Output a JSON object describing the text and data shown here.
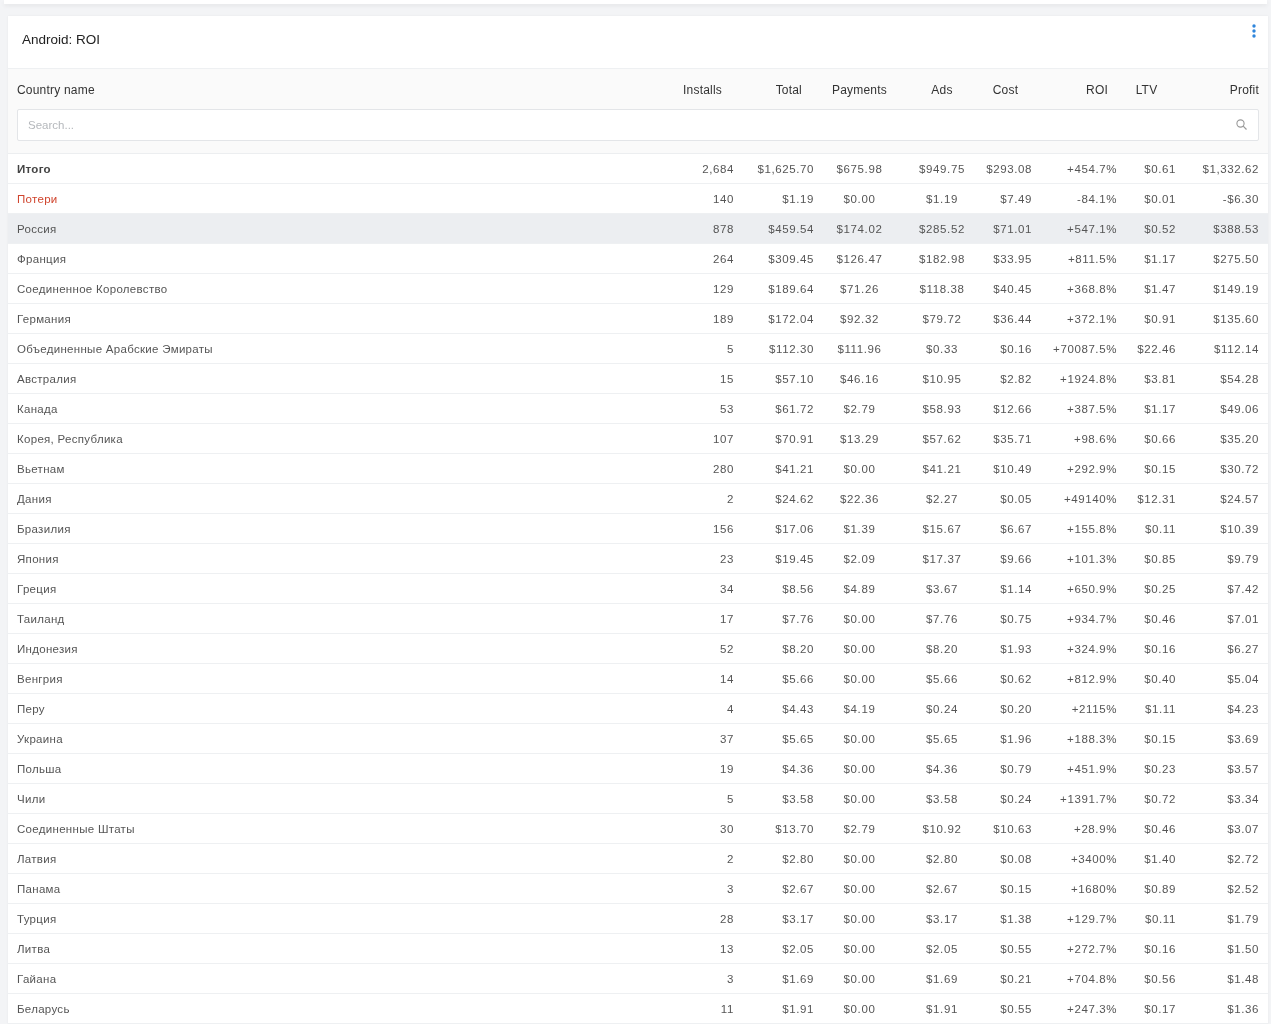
{
  "card": {
    "title": "Android: ROI"
  },
  "table": {
    "columns": [
      "Country name",
      "Installs",
      "Total",
      "Payments",
      "Ads",
      "Cost",
      "ROI",
      "LTV",
      "Profit"
    ],
    "search": {
      "placeholder": "Search..."
    },
    "rows": [
      {
        "kind": "total",
        "selected": false,
        "cells": [
          "Итого",
          "2,684",
          "$1,625.70",
          "$675.98",
          "$949.75",
          "$293.08",
          "+454.7%",
          "$0.61",
          "$1,332.62"
        ]
      },
      {
        "kind": "loss",
        "selected": false,
        "cells": [
          "Потери",
          "140",
          "$1.19",
          "$0.00",
          "$1.19",
          "$7.49",
          "-84.1%",
          "$0.01",
          "-$6.30"
        ]
      },
      {
        "kind": "country",
        "selected": true,
        "cells": [
          "Россия",
          "878",
          "$459.54",
          "$174.02",
          "$285.52",
          "$71.01",
          "+547.1%",
          "$0.52",
          "$388.53"
        ]
      },
      {
        "kind": "country",
        "selected": false,
        "cells": [
          "Франция",
          "264",
          "$309.45",
          "$126.47",
          "$182.98",
          "$33.95",
          "+811.5%",
          "$1.17",
          "$275.50"
        ]
      },
      {
        "kind": "country",
        "selected": false,
        "cells": [
          "Соединенное Королевство",
          "129",
          "$189.64",
          "$71.26",
          "$118.38",
          "$40.45",
          "+368.8%",
          "$1.47",
          "$149.19"
        ]
      },
      {
        "kind": "country",
        "selected": false,
        "cells": [
          "Германия",
          "189",
          "$172.04",
          "$92.32",
          "$79.72",
          "$36.44",
          "+372.1%",
          "$0.91",
          "$135.60"
        ]
      },
      {
        "kind": "country",
        "selected": false,
        "cells": [
          "Объединенные Арабские Эмираты",
          "5",
          "$112.30",
          "$111.96",
          "$0.33",
          "$0.16",
          "+70087.5%",
          "$22.46",
          "$112.14"
        ]
      },
      {
        "kind": "country",
        "selected": false,
        "cells": [
          "Австралия",
          "15",
          "$57.10",
          "$46.16",
          "$10.95",
          "$2.82",
          "+1924.8%",
          "$3.81",
          "$54.28"
        ]
      },
      {
        "kind": "country",
        "selected": false,
        "cells": [
          "Канада",
          "53",
          "$61.72",
          "$2.79",
          "$58.93",
          "$12.66",
          "+387.5%",
          "$1.17",
          "$49.06"
        ]
      },
      {
        "kind": "country",
        "selected": false,
        "cells": [
          "Корея, Республика",
          "107",
          "$70.91",
          "$13.29",
          "$57.62",
          "$35.71",
          "+98.6%",
          "$0.66",
          "$35.20"
        ]
      },
      {
        "kind": "country",
        "selected": false,
        "cells": [
          "Вьетнам",
          "280",
          "$41.21",
          "$0.00",
          "$41.21",
          "$10.49",
          "+292.9%",
          "$0.15",
          "$30.72"
        ]
      },
      {
        "kind": "country",
        "selected": false,
        "cells": [
          "Дания",
          "2",
          "$24.62",
          "$22.36",
          "$2.27",
          "$0.05",
          "+49140%",
          "$12.31",
          "$24.57"
        ]
      },
      {
        "kind": "country",
        "selected": false,
        "cells": [
          "Бразилия",
          "156",
          "$17.06",
          "$1.39",
          "$15.67",
          "$6.67",
          "+155.8%",
          "$0.11",
          "$10.39"
        ]
      },
      {
        "kind": "country",
        "selected": false,
        "cells": [
          "Япония",
          "23",
          "$19.45",
          "$2.09",
          "$17.37",
          "$9.66",
          "+101.3%",
          "$0.85",
          "$9.79"
        ]
      },
      {
        "kind": "country",
        "selected": false,
        "cells": [
          "Греция",
          "34",
          "$8.56",
          "$4.89",
          "$3.67",
          "$1.14",
          "+650.9%",
          "$0.25",
          "$7.42"
        ]
      },
      {
        "kind": "country",
        "selected": false,
        "cells": [
          "Таиланд",
          "17",
          "$7.76",
          "$0.00",
          "$7.76",
          "$0.75",
          "+934.7%",
          "$0.46",
          "$7.01"
        ]
      },
      {
        "kind": "country",
        "selected": false,
        "cells": [
          "Индонезия",
          "52",
          "$8.20",
          "$0.00",
          "$8.20",
          "$1.93",
          "+324.9%",
          "$0.16",
          "$6.27"
        ]
      },
      {
        "kind": "country",
        "selected": false,
        "cells": [
          "Венгрия",
          "14",
          "$5.66",
          "$0.00",
          "$5.66",
          "$0.62",
          "+812.9%",
          "$0.40",
          "$5.04"
        ]
      },
      {
        "kind": "country",
        "selected": false,
        "cells": [
          "Перу",
          "4",
          "$4.43",
          "$4.19",
          "$0.24",
          "$0.20",
          "+2115%",
          "$1.11",
          "$4.23"
        ]
      },
      {
        "kind": "country",
        "selected": false,
        "cells": [
          "Украина",
          "37",
          "$5.65",
          "$0.00",
          "$5.65",
          "$1.96",
          "+188.3%",
          "$0.15",
          "$3.69"
        ]
      },
      {
        "kind": "country",
        "selected": false,
        "cells": [
          "Польша",
          "19",
          "$4.36",
          "$0.00",
          "$4.36",
          "$0.79",
          "+451.9%",
          "$0.23",
          "$3.57"
        ]
      },
      {
        "kind": "country",
        "selected": false,
        "cells": [
          "Чили",
          "5",
          "$3.58",
          "$0.00",
          "$3.58",
          "$0.24",
          "+1391.7%",
          "$0.72",
          "$3.34"
        ]
      },
      {
        "kind": "country",
        "selected": false,
        "cells": [
          "Соединенные Штаты",
          "30",
          "$13.70",
          "$2.79",
          "$10.92",
          "$10.63",
          "+28.9%",
          "$0.46",
          "$3.07"
        ]
      },
      {
        "kind": "country",
        "selected": false,
        "cells": [
          "Латвия",
          "2",
          "$2.80",
          "$0.00",
          "$2.80",
          "$0.08",
          "+3400%",
          "$1.40",
          "$2.72"
        ]
      },
      {
        "kind": "country",
        "selected": false,
        "cells": [
          "Панама",
          "3",
          "$2.67",
          "$0.00",
          "$2.67",
          "$0.15",
          "+1680%",
          "$0.89",
          "$2.52"
        ]
      },
      {
        "kind": "country",
        "selected": false,
        "cells": [
          "Турция",
          "28",
          "$3.17",
          "$0.00",
          "$3.17",
          "$1.38",
          "+129.7%",
          "$0.11",
          "$1.79"
        ]
      },
      {
        "kind": "country",
        "selected": false,
        "cells": [
          "Литва",
          "13",
          "$2.05",
          "$0.00",
          "$2.05",
          "$0.55",
          "+272.7%",
          "$0.16",
          "$1.50"
        ]
      },
      {
        "kind": "country",
        "selected": false,
        "cells": [
          "Гайана",
          "3",
          "$1.69",
          "$0.00",
          "$1.69",
          "$0.21",
          "+704.8%",
          "$0.56",
          "$1.48"
        ]
      },
      {
        "kind": "country",
        "selected": false,
        "cells": [
          "Беларусь",
          "11",
          "$1.91",
          "$0.00",
          "$1.91",
          "$0.55",
          "+247.3%",
          "$0.17",
          "$1.36"
        ]
      }
    ]
  }
}
